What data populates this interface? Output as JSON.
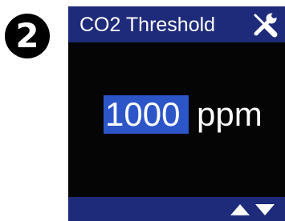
{
  "step": {
    "number": "2"
  },
  "screen": {
    "title": "CO2 Threshold",
    "title_icon": "wrench-screwdriver-icon",
    "value": "1000",
    "unit": "ppm",
    "nav_icons": [
      "up-arrow-icon",
      "down-arrow-icon"
    ]
  },
  "colors": {
    "bar_background": "#1e2a7a",
    "screen_background": "#050505",
    "value_highlight": "#2c56c8",
    "text": "#ffffff"
  }
}
